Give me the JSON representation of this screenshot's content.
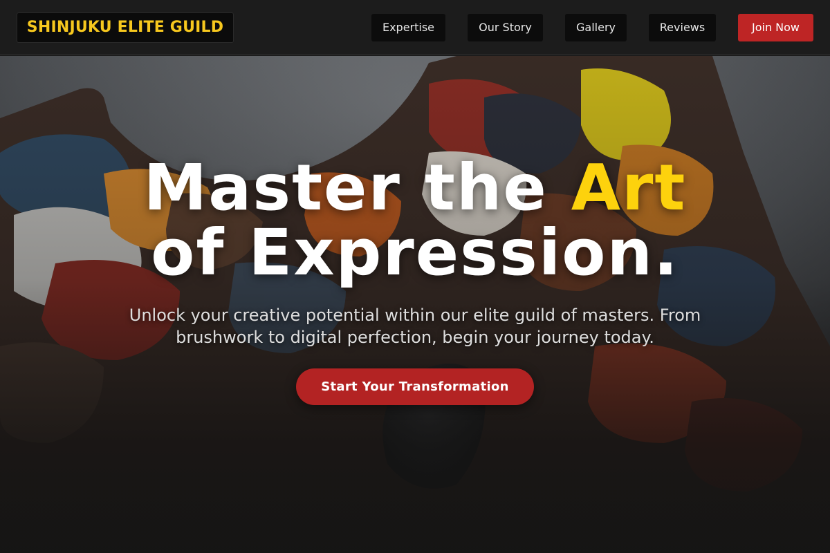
{
  "header": {
    "logo_text": "SHINJUKU ELITE GUILD",
    "nav": [
      {
        "label": "Expertise"
      },
      {
        "label": "Our Story"
      },
      {
        "label": "Gallery"
      },
      {
        "label": "Reviews"
      }
    ],
    "cta_label": "Join Now"
  },
  "hero": {
    "headline_part1": "Master the ",
    "headline_accent": "Art",
    "headline_part2": "of Expression.",
    "subtitle": "Unlock your creative potential within our elite guild of masters. From brushwork to digital perfection, begin your journey today.",
    "cta_label": "Start Your Transformation",
    "background_image": "paint-palette-photo"
  },
  "colors": {
    "accent_yellow": "#fdd20d",
    "logo_yellow": "#f7c81e",
    "brand_red": "#be2525",
    "header_bg": "#1c1c1c"
  }
}
